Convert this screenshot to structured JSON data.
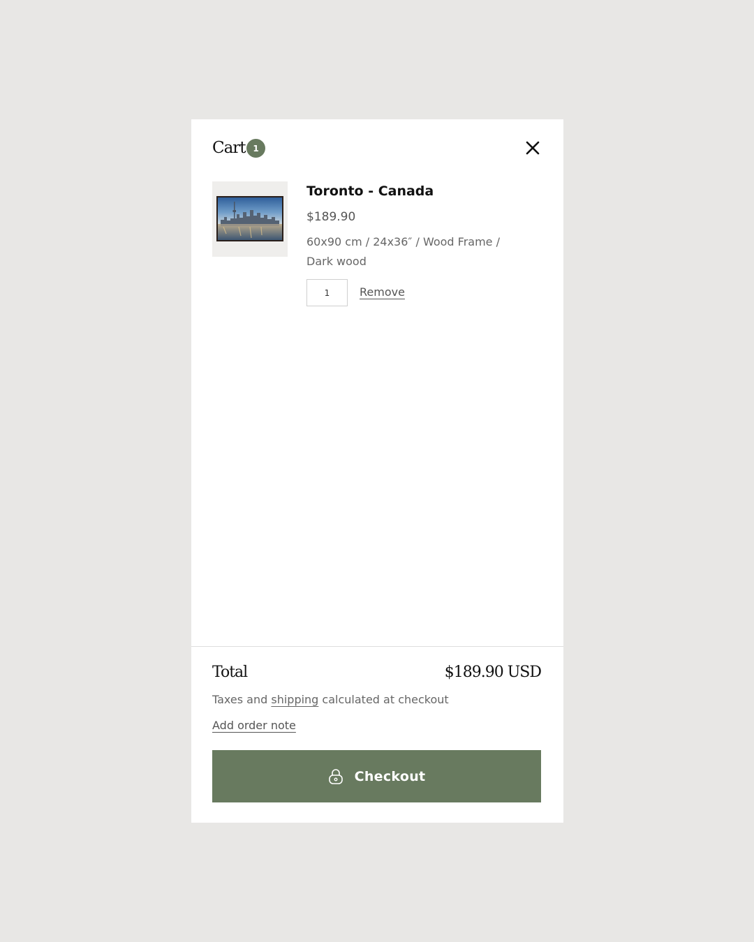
{
  "header": {
    "title": "Cart",
    "count": "1",
    "close_icon": "close-icon"
  },
  "item": {
    "title": "Toronto - Canada",
    "price": "$189.90",
    "variant": "60x90 cm / 24x36″ / Wood Frame / Dark wood",
    "quantity": "1",
    "remove_label": "Remove",
    "image_icon": "framed-toronto-skyline-image"
  },
  "footer": {
    "total_label": "Total",
    "total_value": "$189.90 USD",
    "tax_before": "Taxes and ",
    "tax_link": "shipping",
    "tax_after": " calculated at checkout",
    "order_note_label": "Add order note",
    "checkout_label": "Checkout",
    "checkout_icon": "lock-icon"
  },
  "colors": {
    "background": "#e8e7e5",
    "panel": "#ffffff",
    "accent": "#687a5f"
  }
}
